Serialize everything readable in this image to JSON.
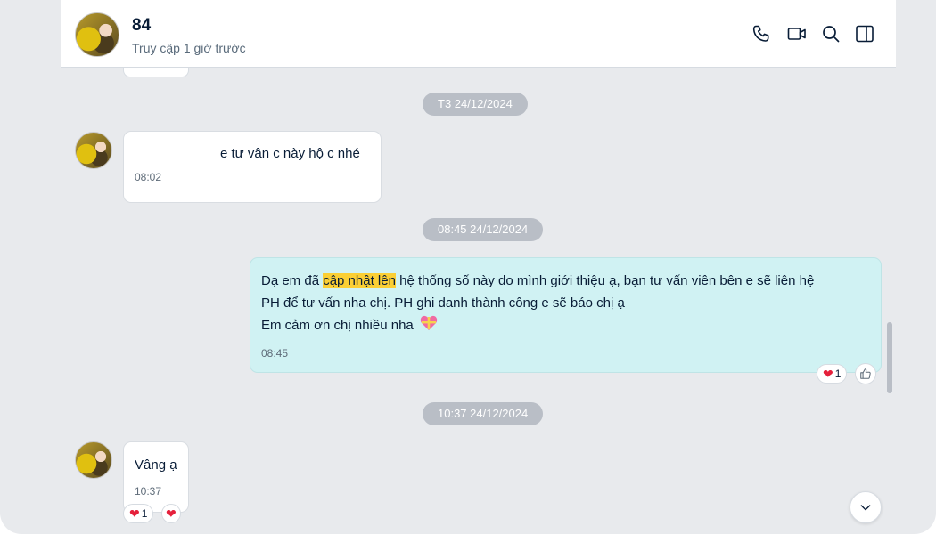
{
  "header": {
    "contact_name": "84",
    "status": "Truy cập 1 giờ trước",
    "icons": [
      "phone-icon",
      "video-call-icon",
      "search-icon",
      "sidebar-toggle-icon"
    ]
  },
  "dates": {
    "first": "T3 24/12/2024",
    "second": "08:45 24/12/2024",
    "third": "10:37 24/12/2024"
  },
  "messages": [
    {
      "sender": "contact",
      "text": "e tư vân c này hộ c nhé",
      "time": "08:02"
    },
    {
      "sender": "me",
      "line1_before": "Dạ em đã ",
      "line1_highlight": "cập nhật lên",
      "line1_after": " hệ thống số này do mình giới thiệu ạ, bạn tư vấn viên bên e sẽ liên hệ",
      "line2": "PH để tư vấn nha chị. PH ghi danh thành công e sẽ báo chị ạ",
      "line3": "Em cảm ơn chị nhiều nha",
      "time": "08:45",
      "reaction_count": "1"
    },
    {
      "sender": "contact",
      "text": "Vâng ạ",
      "time": "10:37",
      "reaction_count": "1"
    }
  ],
  "colors": {
    "background": "#e8eaed",
    "my_bubble": "#d0f2f3",
    "highlight": "#fbcf34",
    "heart": "#e5203b"
  }
}
